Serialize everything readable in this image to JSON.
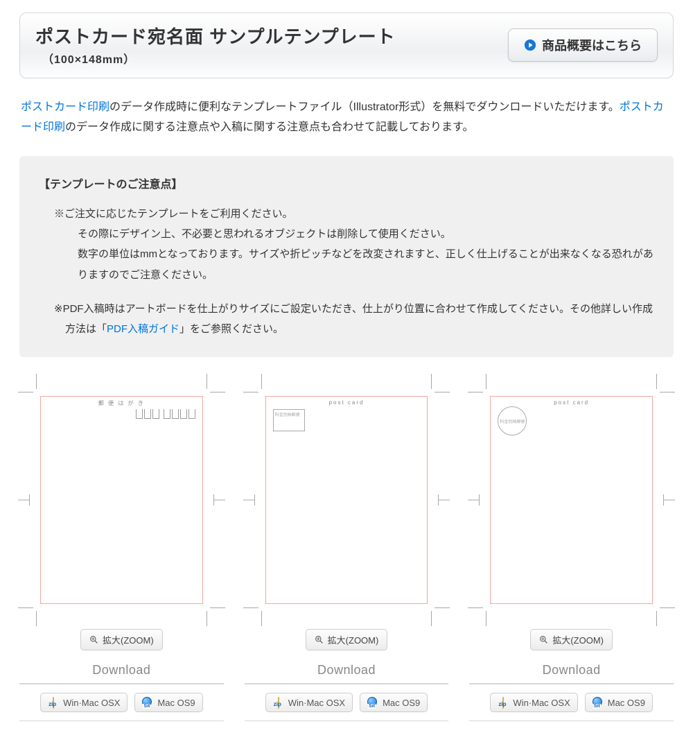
{
  "header": {
    "title": "ポストカード宛名面 サンプルテンプレート",
    "subtitle": "（100×148mm）",
    "cta_label": "商品概要はこちら"
  },
  "intro": {
    "link1": "ポストカード印刷",
    "text1": "のデータ作成時に便利なテンプレートファイル（Illustrator形式）を無料でダウンロードいただけます。",
    "link2": "ポストカード印刷",
    "text2": "のデータ作成に関する注意点や入稿に関する注意点も合わせて記載しております。"
  },
  "notes": {
    "title": "【テンプレートのご注意点】",
    "item1": "※ご注文に応じたテンプレートをご利用ください。",
    "sub1a": "その際にデザイン上、不必要と思われるオブジェクトは削除して使用ください。",
    "sub1b": "数字の単位はmmとなっております。サイズや折ピッチなどを改変されますと、正しく仕上げることが出来なくなる恐れがありますのでご注意ください。",
    "item2a": "※PDF入稿時はアートボードを仕上がりサイズにご設定いただき、仕上がり位置に合わせて作成してください。その他詳しい作成方法は「",
    "item2_link": "PDF入稿ガイド",
    "item2b": "」をご参照ください。"
  },
  "templates": [
    {
      "variant": 1,
      "top_label": "郵 便 は が き",
      "box_text": ""
    },
    {
      "variant": 2,
      "top_label": "post card",
      "box_text": "料金別納郵便"
    },
    {
      "variant": 3,
      "top_label": "post card",
      "box_text": "料金別納郵便"
    }
  ],
  "labels": {
    "zoom": "拡大(ZOOM)",
    "download": "Download",
    "zip_btn": "Win·Mac OSX",
    "sit_btn": "Mac OS9",
    "zip_tag": "zip",
    "sit_tag": "Sit"
  }
}
